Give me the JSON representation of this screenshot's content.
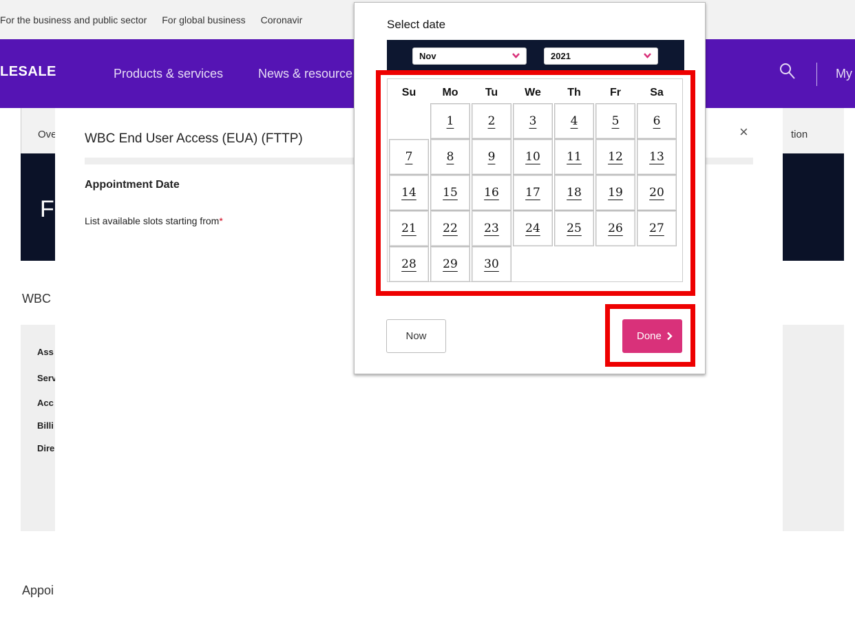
{
  "topbar": {
    "links": [
      "For the business and public sector",
      "For global business",
      "Coronavir"
    ]
  },
  "mainnav": {
    "logo": "LESALE",
    "items": [
      "Products & services",
      "News & resource"
    ],
    "my_label": "My",
    "search_icon": "search-icon"
  },
  "subnav": {
    "left_text": "Ove",
    "right_text": "tion"
  },
  "hero": {
    "letter": "F"
  },
  "background": {
    "heading": "WBC",
    "panel_items": [
      "Ass",
      "Serv",
      "Acc",
      "Billi",
      "Dire"
    ],
    "bottom_heading": "Appoi"
  },
  "modal": {
    "title": "WBC End User Access (EUA) (FTTP)",
    "close_symbol": "×",
    "appointment_label": "Appointment Date",
    "slots_label": "List available slots starting from",
    "required_mark": "*"
  },
  "picker": {
    "title": "Select date",
    "month": "Nov",
    "year": "2021",
    "weekdays": [
      "Su",
      "Mo",
      "Tu",
      "We",
      "Th",
      "Fr",
      "Sa"
    ],
    "first_weekday_index": 1,
    "days": [
      "1",
      "2",
      "3",
      "4",
      "5",
      "6",
      "7",
      "8",
      "9",
      "10",
      "11",
      "12",
      "13",
      "14",
      "15",
      "16",
      "17",
      "18",
      "19",
      "20",
      "21",
      "22",
      "23",
      "24",
      "25",
      "26",
      "27",
      "28",
      "29",
      "30"
    ],
    "now_label": "Now",
    "done_label": "Done"
  },
  "colors": {
    "brand_purple": "#5514b4",
    "done_pink": "#d9317a",
    "highlight_red": "#ee0000",
    "chevron_pink": "#d9317a"
  }
}
